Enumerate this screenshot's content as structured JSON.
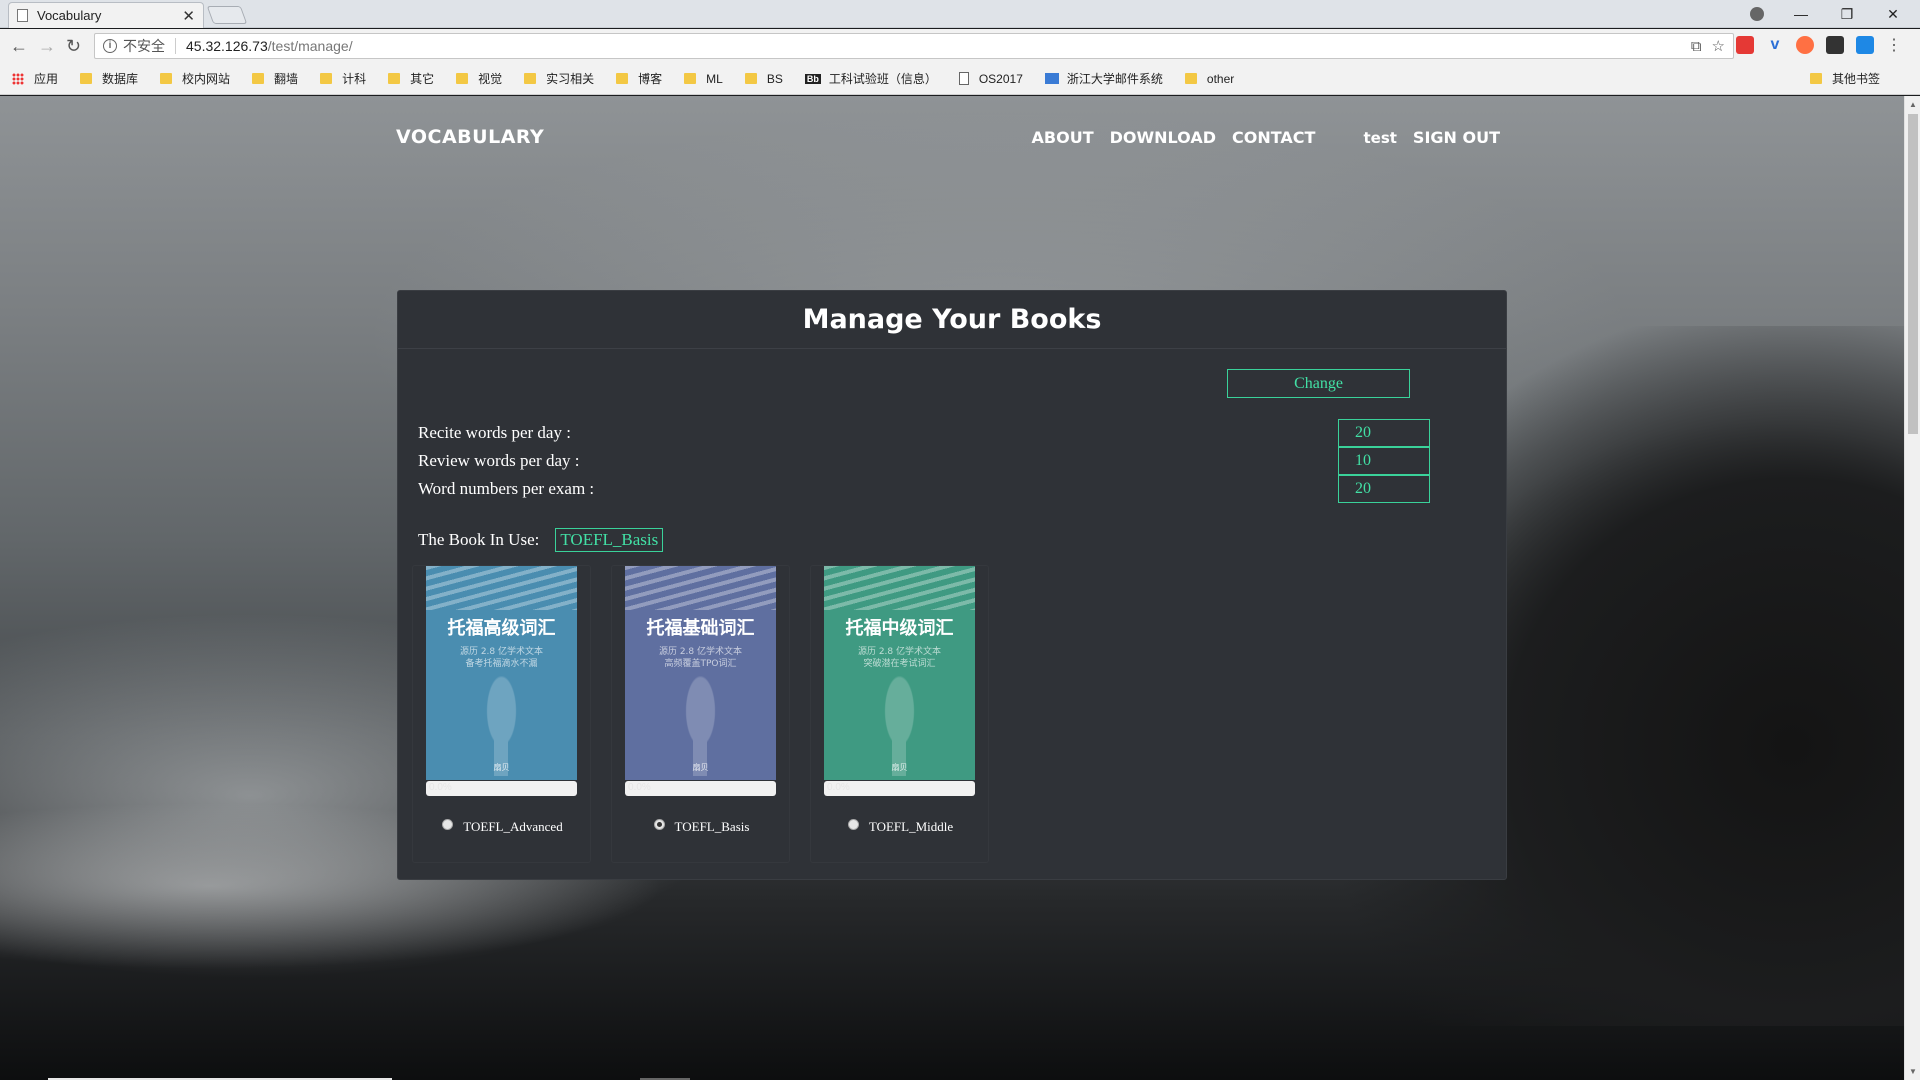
{
  "browser": {
    "tab_title": "Vocabulary",
    "tab_close": "✕",
    "url_security": "不安全",
    "url_host": "45.32.126.73",
    "url_path": "/test/manage/",
    "window_controls": [
      "—",
      "❐",
      "✕"
    ]
  },
  "bookmarks": {
    "apps_label": "应用",
    "items": [
      {
        "label": "数据库",
        "icon": "folder-icon"
      },
      {
        "label": "校内网站",
        "icon": "folder-icon"
      },
      {
        "label": "翻墙",
        "icon": "folder-icon"
      },
      {
        "label": "计科",
        "icon": "folder-icon"
      },
      {
        "label": "其它",
        "icon": "folder-icon"
      },
      {
        "label": "视觉",
        "icon": "folder-icon"
      },
      {
        "label": "实习相关",
        "icon": "folder-icon"
      },
      {
        "label": "博客",
        "icon": "folder-icon"
      },
      {
        "label": "ML",
        "icon": "folder-icon"
      },
      {
        "label": "BS",
        "icon": "folder-icon"
      },
      {
        "label": "工科试验班（信息）",
        "icon": "bb-icon"
      },
      {
        "label": "OS2017",
        "icon": "document-icon"
      },
      {
        "label": "浙江大学邮件系统",
        "icon": "mail-icon"
      },
      {
        "label": "other",
        "icon": "folder-icon"
      }
    ],
    "other_bookmarks": "其他书签"
  },
  "site": {
    "brand": "VOCABULARY",
    "nav": {
      "about": "ABOUT",
      "download": "DOWNLOAD",
      "contact": "CONTACT",
      "user": "test",
      "sign_out": "SIGN OUT"
    }
  },
  "manage": {
    "title": "Manage Your Books",
    "change_button": "Change",
    "settings": {
      "recite": {
        "label": "Recite words per day :",
        "value": "20"
      },
      "review": {
        "label": "Review words per day :",
        "value": "10"
      },
      "exam": {
        "label": "Word numbers per exam :",
        "value": "20"
      }
    },
    "book_in_use_label": "The Book In Use:",
    "book_in_use": "TOEFL_Basis",
    "books": [
      {
        "name": "TOEFL_Advanced",
        "cover_title": "托福高级词汇",
        "cover_sub1": "源历 2.8 亿学术文本",
        "cover_sub2": "备考托福滴水不漏",
        "cover_logo": "扇贝",
        "progress_text": "0.0%",
        "progress": 0.0,
        "selected": false,
        "color": "#4a8db0"
      },
      {
        "name": "TOEFL_Basis",
        "cover_title": "托福基础词汇",
        "cover_sub1": "源历 2.8 亿学术文本",
        "cover_sub2": "高频覆盖TPO词汇",
        "cover_logo": "扇贝",
        "progress_text": "0.0%",
        "progress": 0.0,
        "selected": true,
        "color": "#5f6fa0"
      },
      {
        "name": "TOEFL_Middle",
        "cover_title": "托福中级词汇",
        "cover_sub1": "源历 2.8 亿学术文本",
        "cover_sub2": "突破潜在考试词汇",
        "cover_logo": "扇贝",
        "progress_text": "0.0%",
        "progress": 0.0,
        "selected": false,
        "color": "#3f9a82"
      }
    ]
  },
  "colors": {
    "accent": "#42e0a5",
    "panel_bg": "#2f3237"
  }
}
